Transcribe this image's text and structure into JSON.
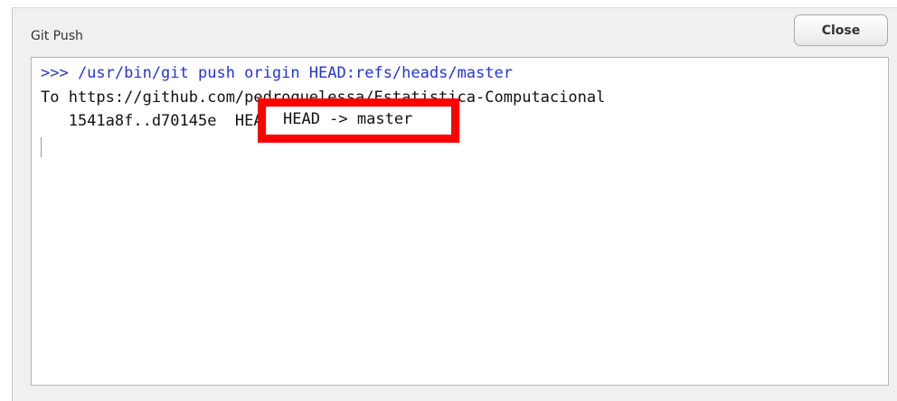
{
  "window": {
    "title": "Git Push"
  },
  "toolbar": {
    "close_label": "Close"
  },
  "output": {
    "lines": [
      ">>> /usr/bin/git push origin HEAD:refs/heads/master",
      "To https://github.com/pedroquelessa/Estatistica-Computacional",
      "   1541a8f..d70145e  HEAD -> master"
    ],
    "highlight_text": "HEAD -> master"
  },
  "colors": {
    "command_text": "#2233dd",
    "output_text": "#111111",
    "highlight_border": "#ff0000",
    "dialog_background": "#f0f0f0"
  }
}
